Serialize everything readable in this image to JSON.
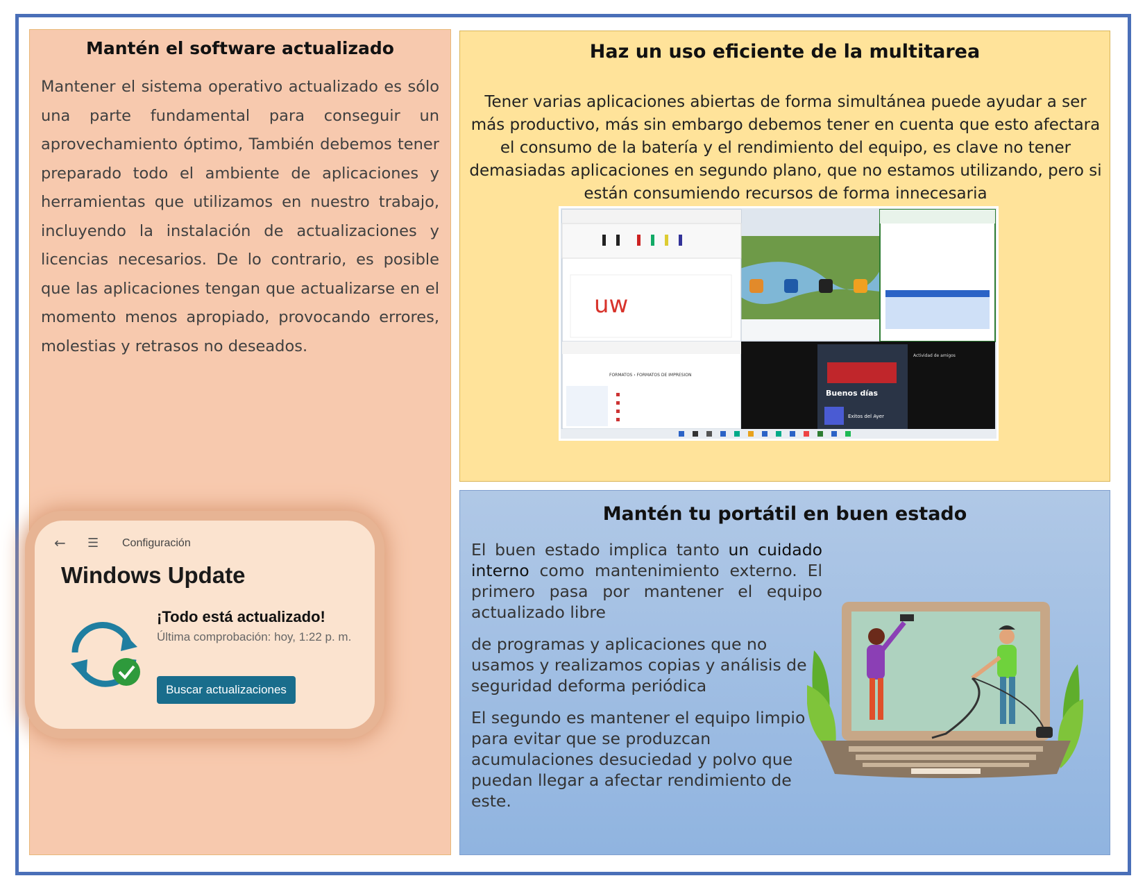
{
  "left": {
    "heading": "Mantén el software actualizado",
    "body": "Mantener el sistema operativo actualizado es sólo una parte fundamental para conseguir un aprovechamiento óptimo, También debemos tener preparado todo el ambiente de aplicaciones y herramientas que utilizamos en nuestro trabajo, incluyendo la instalación de actualizaciones y licencias necesarios. De lo contrario, es posible que las aplicaciones tengan que actualizarse en el momento menos apropiado, provocando errores, molestias y retrasos no deseados.",
    "windows_update": {
      "back_icon": "←",
      "menu_icon": "☰",
      "breadcrumb": "Configuración",
      "title": "Windows Update",
      "status": "¡Todo está actualizado!",
      "last_check": "Última comprobación: hoy, 1:22 p. m.",
      "button": "Buscar actualizaciones",
      "icon": "sync-check-icon"
    }
  },
  "multitask": {
    "heading": "Haz un uso eficiente de la multitarea",
    "body": "Tener varias aplicaciones abiertas de forma simultánea puede ayudar a ser más productivo, más sin embargo debemos tener en cuenta que esto afectara el consumo de la batería y el rendimiento del equipo, es clave no tener demasiadas aplicaciones en segundo plano, que no estamos utilizando, pero si están consumiendo recursos de forma innecesaria",
    "screenshot": {
      "explorer_path": "FORMATOS  ›  FORMATOS DE IMPRESION",
      "music_greeting": "Buenos días",
      "music_list": "Exitos del Ayer",
      "music_activity": "Actividad de amigos",
      "ink": "uw"
    }
  },
  "laptop": {
    "heading": "Mantén tu portátil en buen estado",
    "p1_a": "El buen estado implica tanto ",
    "p1_b": "un cuidado interno",
    "p1_c": " como mantenimiento externo. El primero pasa por mantener el equipo actualizado libre",
    "p2": "de programas y  aplicaciones que no usamos y realizamos copias y análisis de seguridad deforma periódica",
    "p3": "El segundo es mantener el equipo limpio para evitar que se produzcan acumulaciones desuciedad y polvo que puedan llegar a afectar rendimiento de este."
  },
  "colors": {
    "frame": "#4a6fb8",
    "left_panel": "#f7c9ae",
    "multi_panel": "#ffe39a",
    "laptop_panel": "#9fbde3",
    "wu_button": "#196d8c"
  }
}
